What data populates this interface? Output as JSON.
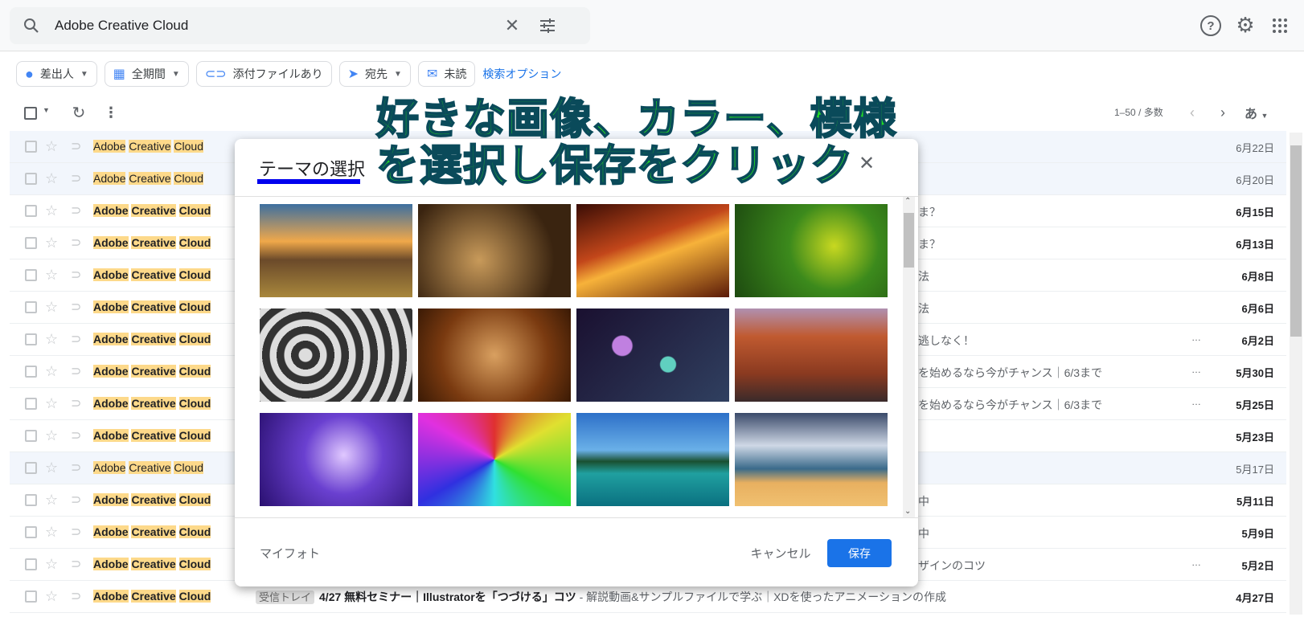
{
  "search": {
    "query": "Adobe Creative Cloud"
  },
  "filters": [
    {
      "label": "差出人",
      "icon": "person-icon",
      "dropdown": true
    },
    {
      "label": "全期間",
      "icon": "calendar-icon",
      "dropdown": true
    },
    {
      "label": "添付ファイルあり",
      "icon": "attachment-icon",
      "dropdown": false
    },
    {
      "label": "宛先",
      "icon": "send-icon",
      "dropdown": true
    },
    {
      "label": "未読",
      "icon": "unread-icon",
      "dropdown": false
    }
  ],
  "advanced_search": "検索オプション",
  "pagination": {
    "range": "1–50 / 多数",
    "input_tool": "あ"
  },
  "sender": {
    "w1": "Adobe",
    "w2": "Creative",
    "w3": "Cloud"
  },
  "emails": [
    {
      "snippet": "",
      "date": "6月22日",
      "read": true,
      "dots": false
    },
    {
      "snippet": "",
      "date": "6月20日",
      "read": true,
      "dots": false
    },
    {
      "snippet": "ま？",
      "date": "6月15日",
      "read": false,
      "dots": false
    },
    {
      "snippet": "ま？",
      "date": "6月13日",
      "read": false,
      "dots": false
    },
    {
      "snippet": "法",
      "date": "6月8日",
      "read": false,
      "dots": false
    },
    {
      "snippet": "法",
      "date": "6月6日",
      "read": false,
      "dots": false
    },
    {
      "snippet": "逃しなく！",
      "date": "6月2日",
      "read": false,
      "dots": true
    },
    {
      "snippet": "を始めるなら今がチャンス｜6/3まで",
      "date": "5月30日",
      "read": false,
      "dots": true
    },
    {
      "snippet": "を始めるなら今がチャンス｜6/3まで",
      "date": "5月25日",
      "read": false,
      "dots": true
    },
    {
      "snippet": "",
      "date": "5月23日",
      "read": false,
      "dots": false
    },
    {
      "snippet": "",
      "date": "5月17日",
      "read": true,
      "dots": false
    },
    {
      "snippet": "中",
      "date": "5月11日",
      "read": false,
      "dots": false
    },
    {
      "snippet": "中",
      "date": "5月9日",
      "read": false,
      "dots": false
    },
    {
      "snippet": "ザインのコツ",
      "date": "5月2日",
      "read": false,
      "dots": true
    },
    {
      "snippet": "",
      "date": "4月27日",
      "read": false,
      "dots": false,
      "label": "受信トレイ",
      "subject": "4/27 無料セミナー｜Illustratorを「つづける」コツ",
      "preview": " - 解説動画&サンプルファイルで学ぶ｜XDを使ったアニメーションの作成"
    }
  ],
  "dialog": {
    "title": "テーマの選択",
    "my_photos": "マイフォト",
    "cancel": "キャンセル",
    "save": "保存",
    "themes": [
      "golden-gate",
      "chess",
      "canyon",
      "caterpillar",
      "pipes",
      "autumn-leaves",
      "bokeh",
      "grand-canyon",
      "jellyfish",
      "rainbow-water",
      "lake",
      "beach"
    ]
  },
  "annotation": {
    "line1": "好きな画像、カラー、模様",
    "line2": "を選択し保存をクリック"
  },
  "colors": {
    "accent": "#1a73e8",
    "highlight": "#fdd98a",
    "annotation": "#22dd22"
  }
}
